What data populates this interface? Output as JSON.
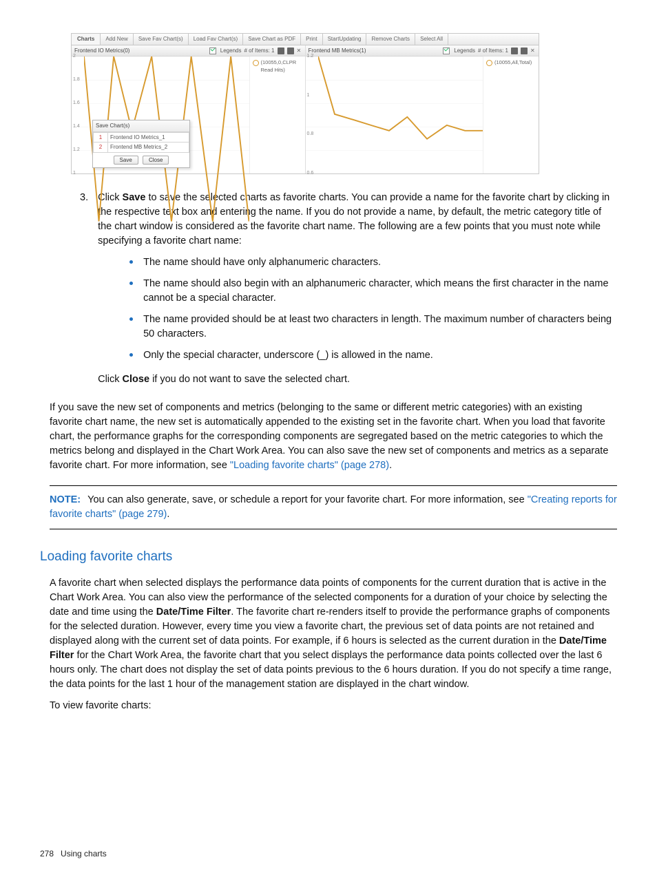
{
  "app": {
    "tabs_label": "Charts",
    "toolbar": [
      "Add New",
      "Save Fav Chart(s)",
      "Load Fav Chart(s)",
      "Save Chart as PDF",
      "Print",
      "StartUpdating",
      "Remove Charts",
      "Select All"
    ],
    "panels": [
      {
        "title": "Frontend IO Metrics(0)",
        "legends_label": "Legends",
        "items_label": "# of Items: 1",
        "legend_text": "(10055,0,CLPR Read Hits)"
      },
      {
        "title": "Frontend MB Metrics(1)",
        "legends_label": "Legends",
        "items_label": "# of Items: 1",
        "legend_text": "(10055,All,Total)"
      }
    ],
    "dialog": {
      "title": "Save Chart(s)",
      "rows": [
        {
          "idx": "1",
          "name": "Frontend IO Metrics_1"
        },
        {
          "idx": "2",
          "name": "Frontend MB Metrics_2"
        }
      ],
      "save": "Save",
      "close": "Close"
    }
  },
  "chart_data": [
    {
      "type": "line",
      "title": "Frontend IO Metrics(0)",
      "ylim": [
        1.0,
        2.0
      ],
      "yticks": [
        "2",
        "1.8",
        "1.6",
        "1.4",
        "1.2",
        "1"
      ],
      "series": [
        {
          "name": "(10055,0,CLPR Read Hits)",
          "x": [
            0,
            9,
            18,
            29,
            41,
            53,
            65,
            78,
            89,
            100
          ],
          "y": [
            2.0,
            1.0,
            2.0,
            1.55,
            2.0,
            1.0,
            2.0,
            1.0,
            2.0,
            1.0
          ]
        }
      ]
    },
    {
      "type": "line",
      "title": "Frontend MB Metrics(1)",
      "ylim": [
        0.6,
        1.2
      ],
      "yticks": [
        "1.2",
        "1",
        "0.8",
        "0.6"
      ],
      "series": [
        {
          "name": "(10055,All,Total)",
          "x": [
            0,
            10,
            21,
            32,
            43,
            54,
            66,
            78,
            89,
            100
          ],
          "y": [
            1.2,
            0.99,
            0.97,
            0.95,
            0.93,
            0.98,
            0.9,
            0.95,
            0.93,
            0.93
          ]
        }
      ]
    }
  ],
  "doc": {
    "step_number": "3.",
    "step_text_1": "Click ",
    "step_save": "Save",
    "step_text_2": " to save the selected charts as favorite charts. You can provide a name for the favorite chart by clicking in the respective text box and entering the name. If you do not provide a name, by default, the metric category title of the chart window is considered as the favorite chart name. The following are a few points that you must note while specifying a favorite chart name:",
    "bullets": [
      "The name should have only alphanumeric characters.",
      "The name should also begin with an alphanumeric character, which means the first character in the name cannot be a special character.",
      "The name provided should be at least two characters in length. The maximum number of characters being 50 characters.",
      "Only the special character, underscore (_) is allowed in the name."
    ],
    "close_text_1": "Click ",
    "close_bold": "Close",
    "close_text_2": " if you do not want to save the selected chart.",
    "para2_a": "If you save the new set of components and metrics (belonging to the same or different metric categories) with an existing favorite chart name, the new set is automatically appended to the existing set in the favorite chart. When you load that favorite chart, the performance graphs for the corresponding components are segregated based on the metric categories to which the metrics belong and displayed in the Chart Work Area. You can also save the new set of components and metrics as a separate favorite chart. For more information, see ",
    "para2_link": "\"Loading favorite charts\" (page 278)",
    "para2_b": ".",
    "note_label": "NOTE:",
    "note_a": "You can also generate, save, or schedule a report for your favorite chart. For more information, see ",
    "note_link": "\"Creating reports for favorite charts\" (page 279)",
    "note_b": ".",
    "h2": "Loading favorite charts",
    "lfc_p1_a": "A favorite chart when selected displays the performance data points of components for the current duration that is active in the Chart Work Area. You can also view the performance of the selected components for a duration of your choice by selecting the date and time using the ",
    "lfc_p1_bold1": "Date/Time Filter",
    "lfc_p1_b": ". The favorite chart re-renders itself to provide the performance graphs of components for the selected duration. However, every time you view a favorite chart, the previous set of data points are not retained and displayed along with the current set of data points. For example, if 6 hours is selected as the current duration in the ",
    "lfc_p1_bold2": "Date/Time Filter",
    "lfc_p1_c": " for the Chart Work Area, the favorite chart that you select displays the performance data points collected over the last 6 hours only. The chart does not display the set of data points previous to the 6 hours duration. If you do not specify a time range, the data points for the last 1 hour of the management station are displayed in the chart window.",
    "lfc_p2": "To view favorite charts:",
    "footer_page": "278",
    "footer_title": "Using charts"
  }
}
